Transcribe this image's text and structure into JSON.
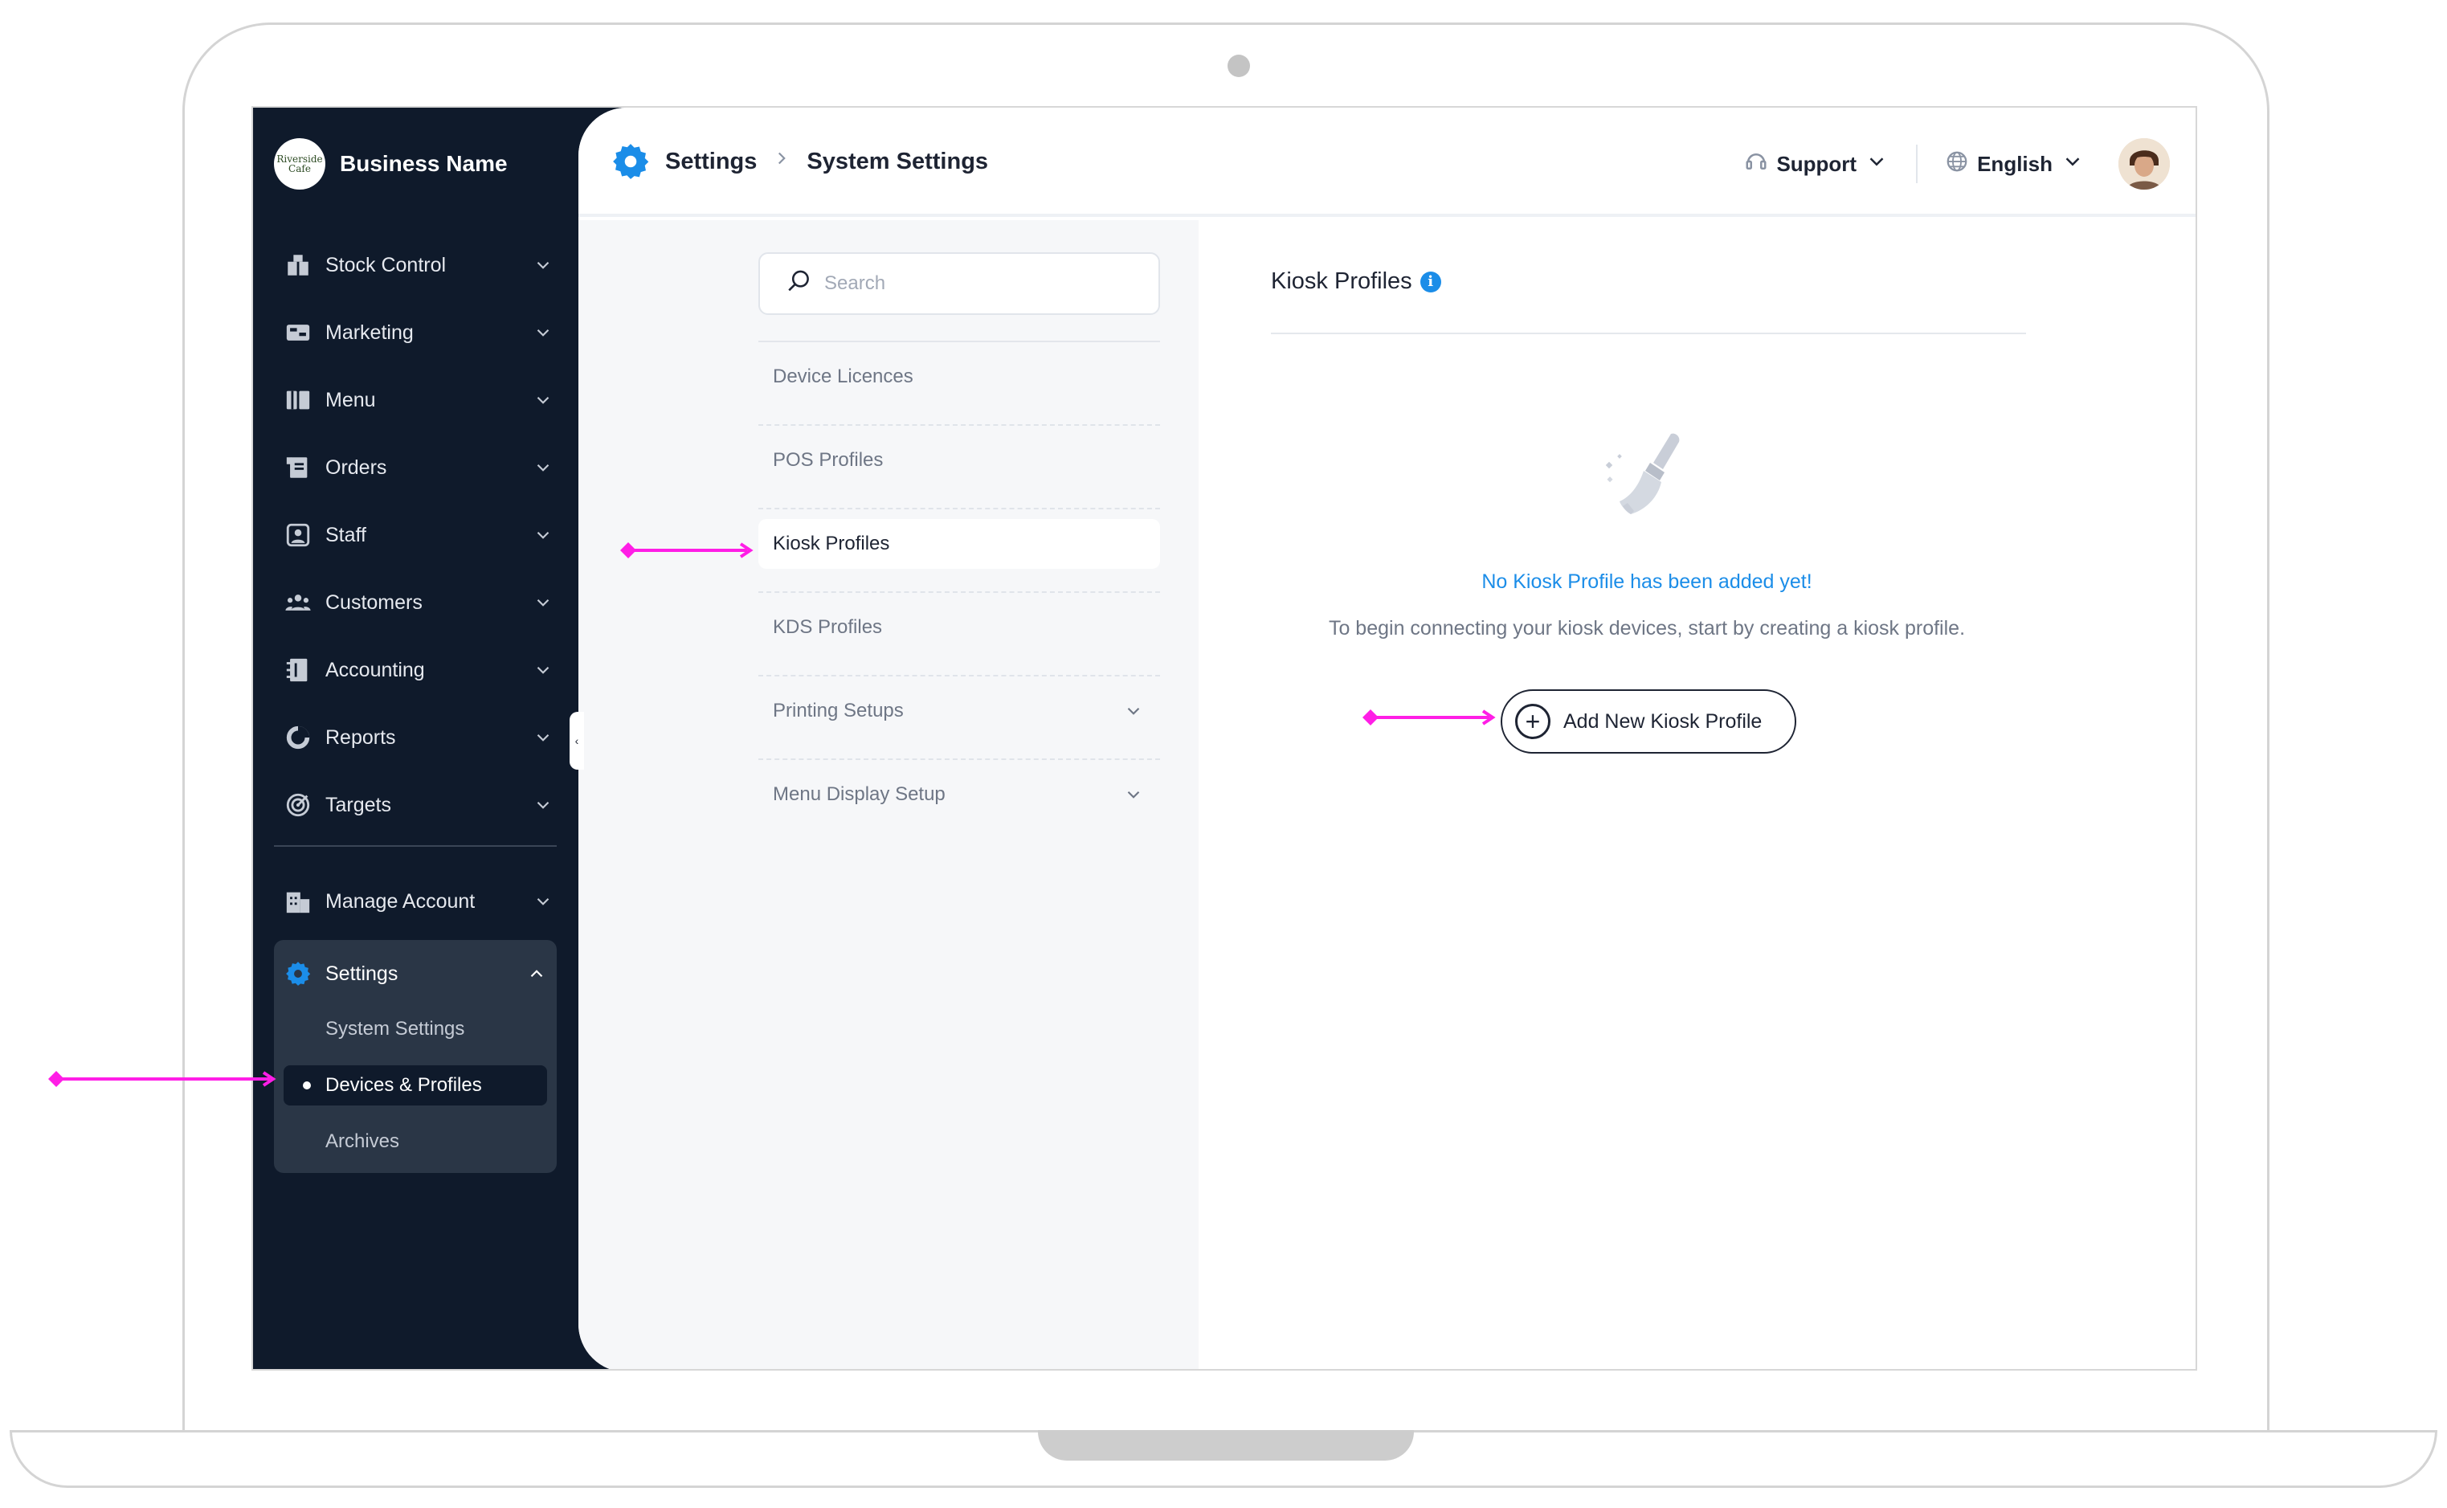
{
  "brand": {
    "logo_text": "Riverside Cafe",
    "name": "Business Name"
  },
  "sidebar": {
    "items": [
      {
        "label": "Stock Control",
        "icon": "stock-control-icon"
      },
      {
        "label": "Marketing",
        "icon": "marketing-icon"
      },
      {
        "label": "Menu",
        "icon": "menu-book-icon"
      },
      {
        "label": "Orders",
        "icon": "orders-icon"
      },
      {
        "label": "Staff",
        "icon": "staff-icon"
      },
      {
        "label": "Customers",
        "icon": "customers-icon"
      },
      {
        "label": "Accounting",
        "icon": "accounting-icon"
      },
      {
        "label": "Reports",
        "icon": "reports-icon"
      },
      {
        "label": "Targets",
        "icon": "targets-icon"
      }
    ],
    "manage_account": "Manage Account",
    "settings": {
      "label": "Settings",
      "children": [
        "System Settings",
        "Devices & Profiles",
        "Archives"
      ],
      "active_child": "Devices & Profiles"
    }
  },
  "topbar": {
    "breadcrumb": [
      "Settings",
      "System Settings"
    ],
    "support_label": "Support",
    "language_label": "English"
  },
  "settings_menu": {
    "search_placeholder": "Search",
    "items": [
      "Device Licences",
      "POS Profiles",
      "Kiosk Profiles",
      "KDS Profiles",
      "Printing Setups",
      "Menu Display Setup"
    ],
    "active": "Kiosk Profiles"
  },
  "content": {
    "title": "Kiosk Profiles",
    "empty_title": "No Kiosk Profile has been added yet!",
    "empty_desc": "To begin connecting your kiosk devices, start by creating a kiosk profile.",
    "add_button": "Add New Kiosk Profile"
  },
  "colors": {
    "sidebar_bg": "#0f1a2b",
    "accent_blue": "#1b8de8",
    "annotation_magenta": "#ff1ee6"
  }
}
